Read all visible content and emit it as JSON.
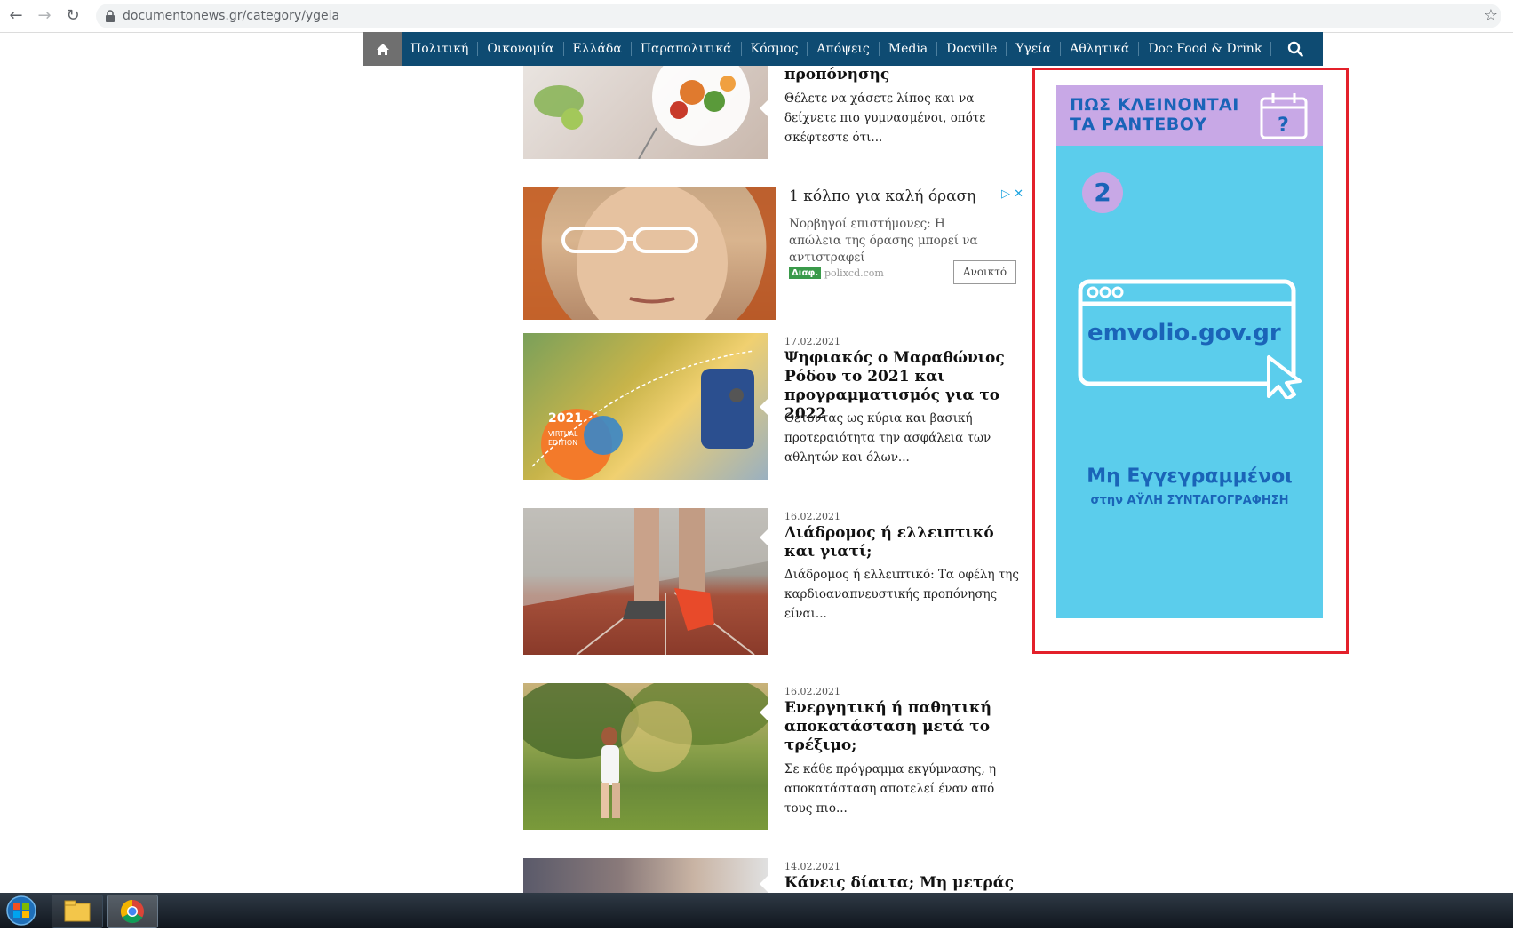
{
  "browser": {
    "url": "documentonews.gr/category/ygeia",
    "back_icon": "←",
    "forward_icon": "→",
    "reload_icon": "↻",
    "star_icon": "☆"
  },
  "nav": {
    "home_icon": "home-icon",
    "items": [
      "Πολιτική",
      "Οικονομία",
      "Ελλάδα",
      "Παραπολιτικά",
      "Κόσμος",
      "Απόψεις",
      "Media",
      "Docville",
      "Υγεία",
      "Αθλητικά",
      "Doc Food & Drink"
    ]
  },
  "articles": [
    {
      "date": "",
      "title": "προπόνησης",
      "excerpt": "Θέλετε να χάσετε λίπος και να δείχνετε πιο γυμνασμένοι, οπότε σκέφτεστε ότι..."
    },
    {
      "date": "17.02.2021",
      "title": "Ψηφιακός ο Μαραθώνιος Ρόδου το 2021 και προγραμματισμός για το 2022",
      "excerpt": "Θέτοντας ως κύρια και βασική προτεραιότητα την ασφάλεια των αθλητών και όλων...",
      "thumb_text": "2021 VIRTUAL EDITION"
    },
    {
      "date": "16.02.2021",
      "title": "Διάδρομος ή ελλειπτικό και γιατί;",
      "excerpt": "Διάδρομος ή ελλειπτικό: Τα οφέλη της καρδιοαναπνευστικής προπόνησης είναι..."
    },
    {
      "date": "16.02.2021",
      "title": "Ενεργητική ή παθητική αποκατάσταση μετά το τρέξιμο;",
      "excerpt": "Σε κάθε πρόγραμμα εκγύμνασης, η αποκατάσταση αποτελεί έναν από τους πιο..."
    },
    {
      "date": "14.02.2021",
      "title": "Κάνεις δίαιτα; Μη μετράς",
      "excerpt": ""
    }
  ],
  "native_ad": {
    "title": "1 κόλπο για καλή όραση",
    "body": "Νορβηγοί επιστήμονες: Η απώλεια της όρασης μπορεί να αντιστραφεί",
    "badge": "Διαφ.",
    "source": "polixcd.com",
    "button": "Ανοικτό"
  },
  "side_ad": {
    "headline_line1": "ΠΩΣ ΚΛΕΙΝΟΝΤΑΙ",
    "headline_line2": "ΤΑ ΡΑΝΤΕΒΟΥ",
    "step": "2",
    "site": "emvolio.gov.gr",
    "cta_line1": "Μη Εγγεγραμμένοι",
    "cta_line2": "στην ΑΫΛΗ ΣΥΝΤΑΓΟΓΡΑΦΗΣΗ",
    "colors": {
      "bg": "#5bcdec",
      "header": "#c8a8e6",
      "text": "#1a64b8",
      "highlight": "#e3202a"
    }
  }
}
